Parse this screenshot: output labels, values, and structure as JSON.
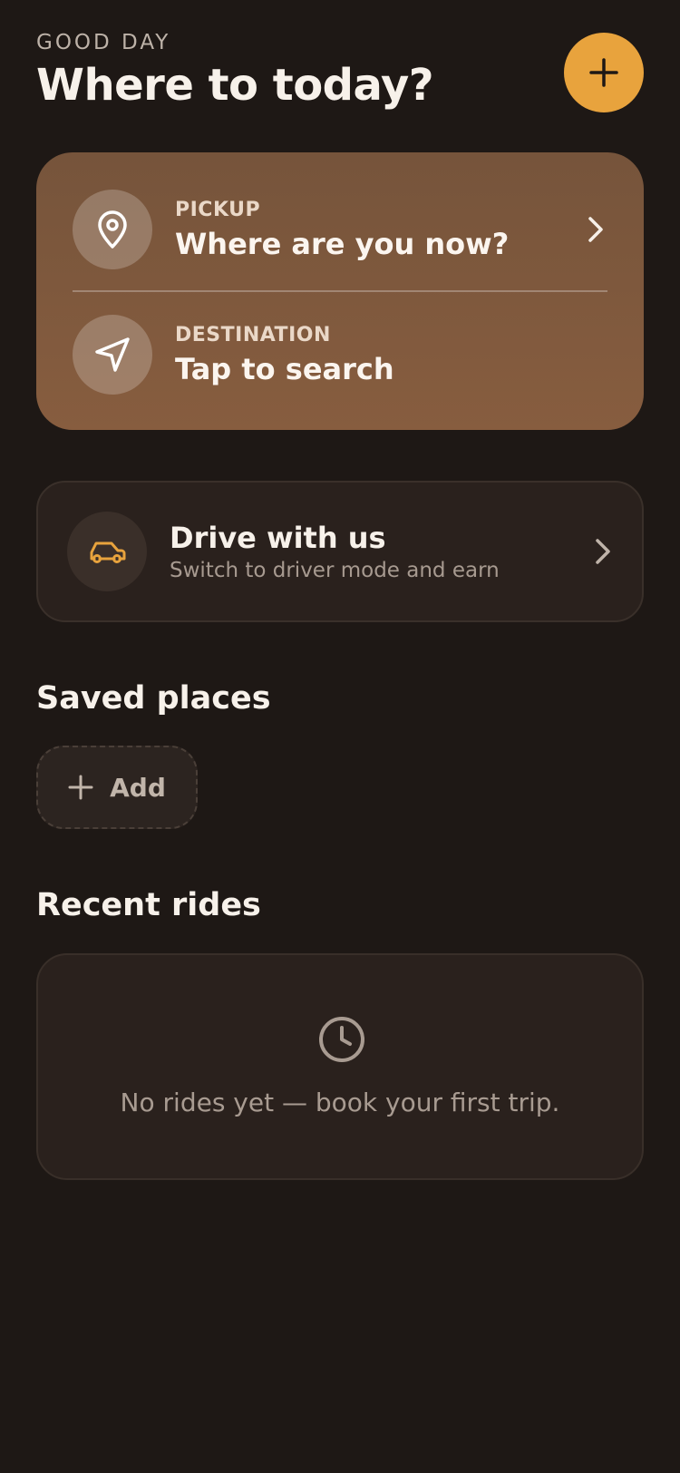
{
  "header": {
    "greeting": "GOOD DAY",
    "title": "Where to today?"
  },
  "fab": {
    "icon": "plus-icon"
  },
  "route": {
    "pickup": {
      "label": "PICKUP",
      "value": "Where are you now?",
      "icon": "map-pin-icon"
    },
    "destination": {
      "label": "DESTINATION",
      "value": "Tap to search",
      "icon": "navigation-arrow-icon"
    }
  },
  "drive": {
    "title": "Drive with us",
    "subtitle": "Switch to driver mode and earn",
    "icon": "car-icon"
  },
  "saved_places": {
    "title": "Saved places",
    "add_label": "Add"
  },
  "recent_rides": {
    "title": "Recent rides",
    "empty_text": "No rides yet — book your first trip.",
    "icon": "clock-icon"
  },
  "colors": {
    "background": "#1e1815",
    "accent": "#e8a33d",
    "card_brown": "#875d3f"
  }
}
